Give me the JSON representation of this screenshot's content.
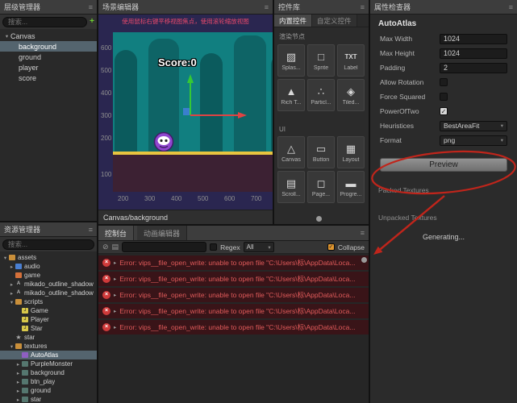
{
  "colors": {
    "annotation": "#c0251b",
    "error_text": "#e25b5b",
    "selection": "#54646e",
    "accent_green": "#6fd130",
    "ground_yellow": "#e8c53f",
    "scene_teal": "#117f80",
    "collapse_orange": "#e0962f",
    "hint_red": "#e8496b"
  },
  "icons": {
    "menu": "≡",
    "plus": "+",
    "clear": "⊘",
    "filter": "▤",
    "caret": "▾",
    "expand_closed": "▸",
    "expand_open": "▾",
    "error": "×",
    "check": "✓"
  },
  "hierarchy": {
    "title": "层级管理器",
    "search_placeholder": "搜索...",
    "tree": [
      {
        "label": "Canvas",
        "depth": 0,
        "exp": "open",
        "selected": false
      },
      {
        "label": "background",
        "depth": 1,
        "exp": "none",
        "selected": true
      },
      {
        "label": "ground",
        "depth": 1,
        "exp": "none",
        "selected": false
      },
      {
        "label": "player",
        "depth": 1,
        "exp": "none",
        "selected": false
      },
      {
        "label": "score",
        "depth": 1,
        "exp": "none",
        "selected": false
      }
    ]
  },
  "assets": {
    "title": "资源管理器",
    "search_placeholder": "搜索...",
    "tree": [
      {
        "label": "assets",
        "depth": 0,
        "icon": "folder",
        "exp": "open",
        "selected": false
      },
      {
        "label": "audio",
        "depth": 1,
        "icon": "audio",
        "exp": "closed",
        "selected": false
      },
      {
        "label": "game",
        "depth": 1,
        "icon": "game",
        "exp": "none",
        "selected": false
      },
      {
        "label": "mikado_outline_shadow",
        "depth": 1,
        "icon": "font",
        "exp": "closed",
        "selected": false
      },
      {
        "label": "mikado_outline_shadow",
        "depth": 1,
        "icon": "font",
        "exp": "closed",
        "selected": false
      },
      {
        "label": "scripts",
        "depth": 1,
        "icon": "folder",
        "exp": "open",
        "selected": false
      },
      {
        "label": "Game",
        "depth": 2,
        "icon": "js",
        "exp": "none",
        "selected": false
      },
      {
        "label": "Player",
        "depth": 2,
        "icon": "js",
        "exp": "none",
        "selected": false
      },
      {
        "label": "Star",
        "depth": 2,
        "icon": "js",
        "exp": "none",
        "selected": false
      },
      {
        "label": "star",
        "depth": 1,
        "icon": "star",
        "exp": "none",
        "selected": false
      },
      {
        "label": "textures",
        "depth": 1,
        "icon": "folder",
        "exp": "open",
        "selected": false
      },
      {
        "label": "AutoAtlas",
        "depth": 2,
        "icon": "atlas",
        "exp": "none",
        "selected": true
      },
      {
        "label": "PurpleMonster",
        "depth": 2,
        "icon": "image",
        "exp": "closed",
        "selected": false
      },
      {
        "label": "background",
        "depth": 2,
        "icon": "image",
        "exp": "closed",
        "selected": false
      },
      {
        "label": "btn_play",
        "depth": 2,
        "icon": "image",
        "exp": "closed",
        "selected": false
      },
      {
        "label": "ground",
        "depth": 2,
        "icon": "image",
        "exp": "closed",
        "selected": false
      },
      {
        "label": "star",
        "depth": 2,
        "icon": "image",
        "exp": "closed",
        "selected": false
      }
    ]
  },
  "scene": {
    "title": "场景编辑器",
    "hint": "使用鼠标右键平移视图焦点，使用滚轮缩放视图",
    "score_label": "Score:0",
    "ruler_y": [
      "600",
      "500",
      "400",
      "300",
      "200",
      "100"
    ],
    "ruler_x": [
      "200",
      "300",
      "400",
      "500",
      "600",
      "700"
    ],
    "footer": "Canvas/background"
  },
  "widgets": {
    "title": "控件库",
    "tabs": [
      {
        "label": "内置控件",
        "active": true
      },
      {
        "label": "自定义控件",
        "active": false
      }
    ],
    "sections": [
      {
        "label": "渲染节点",
        "items": [
          {
            "label": "Splas...",
            "icon": "splash"
          },
          {
            "label": "Sprite",
            "icon": "sprite"
          },
          {
            "label": "Label",
            "icon": "label"
          },
          {
            "label": "Rich T...",
            "icon": "richtext"
          },
          {
            "label": "Particl...",
            "icon": "particle"
          },
          {
            "label": "Tiled...",
            "icon": "tiledmap"
          }
        ]
      },
      {
        "label": "UI",
        "items": [
          {
            "label": "Canvas",
            "icon": "canvas"
          },
          {
            "label": "Button",
            "icon": "button"
          },
          {
            "label": "Layout",
            "icon": "layout"
          },
          {
            "label": "Scroll...",
            "icon": "scrollview"
          },
          {
            "label": "Page...",
            "icon": "pageview"
          },
          {
            "label": "Progre...",
            "icon": "progressbar"
          }
        ]
      }
    ]
  },
  "console": {
    "tabs": [
      "控制台",
      "动画编辑器"
    ],
    "regex_label": "Regex",
    "filter_value": "All",
    "collapse_label": "Collapse",
    "collapse_checked": true,
    "errors": [
      "Error: vips__file_open_write: unable to open file \"C:\\Users\\标\\AppData\\Loca...",
      "Error: vips__file_open_write: unable to open file \"C:\\Users\\标\\AppData\\Loca...",
      "Error: vips__file_open_write: unable to open file \"C:\\Users\\标\\AppData\\Loca...",
      "Error: vips__file_open_write: unable to open file \"C:\\Users\\标\\AppData\\Loca...",
      "Error: vips__file_open_write: unable to open file \"C:\\Users\\标\\AppData\\Loca..."
    ]
  },
  "inspector": {
    "title": "属性检查器",
    "asset_name": "AutoAtlas",
    "fields": [
      {
        "label": "Max Width",
        "type": "input",
        "value": "1024"
      },
      {
        "label": "Max Height",
        "type": "input",
        "value": "1024"
      },
      {
        "label": "Padding",
        "type": "input",
        "value": "2"
      },
      {
        "label": "Allow Rotation",
        "type": "checkbox",
        "checked": false
      },
      {
        "label": "Force Squared",
        "type": "checkbox",
        "checked": false
      },
      {
        "label": "PowerOfTwo",
        "type": "checkbox",
        "checked": true
      },
      {
        "label": "Heuristices",
        "type": "select",
        "value": "BestAreaFit"
      },
      {
        "label": "Format",
        "type": "select",
        "value": "png"
      }
    ],
    "preview_button": "Preview",
    "packed_label": "Packed Textures",
    "unpacked_label": "Unpacked Textures",
    "generating": "Generating..."
  }
}
